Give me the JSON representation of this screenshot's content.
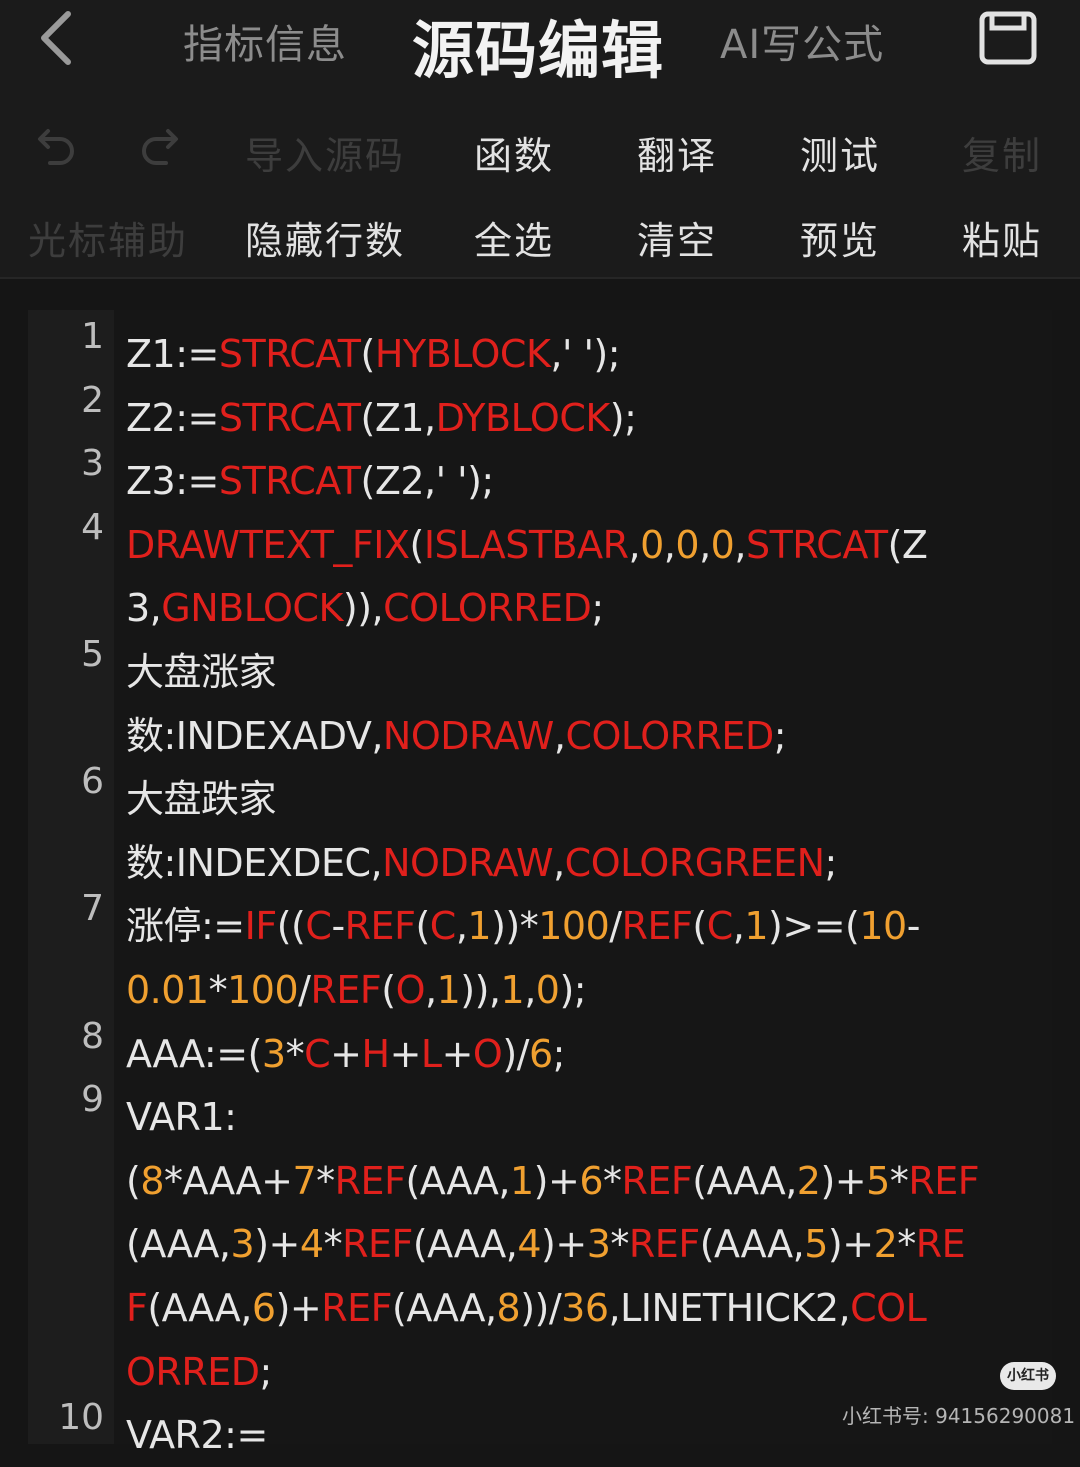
{
  "header": {
    "tabs": [
      {
        "label": "指标信息"
      },
      {
        "label": "源码编辑"
      },
      {
        "label": "AI写公式"
      }
    ]
  },
  "toolbar": {
    "row1": [
      "导入源码",
      "函数",
      "翻译",
      "测试",
      "复制"
    ],
    "row2": [
      "光标辅助",
      "隐藏行数",
      "全选",
      "清空",
      "预览",
      "粘贴"
    ]
  },
  "editor": {
    "line_numbers": [
      "1",
      "2",
      "3",
      "4",
      "5",
      "6",
      "7",
      "8",
      "9",
      "10"
    ],
    "lines": [
      {
        "ln": "1",
        "segs": [
          [
            "Z1:=",
            ""
          ],
          [
            "STRCAT",
            "r"
          ],
          [
            "(",
            ""
          ],
          [
            "HYBLOCK",
            "r"
          ],
          [
            ",' ');",
            ""
          ]
        ]
      },
      {
        "ln": "2",
        "segs": [
          [
            "Z2:=",
            ""
          ],
          [
            "STRCAT",
            "r"
          ],
          [
            "(Z1,",
            ""
          ],
          [
            "DYBLOCK",
            "r"
          ],
          [
            ");",
            ""
          ]
        ]
      },
      {
        "ln": "3",
        "segs": [
          [
            "Z3:=",
            ""
          ],
          [
            "STRCAT",
            "r"
          ],
          [
            "(Z2,' ');",
            ""
          ]
        ]
      },
      {
        "ln": "4",
        "segs": [
          [
            "DRAWTEXT_FIX",
            "r"
          ],
          [
            "(",
            ""
          ],
          [
            "ISLASTBAR",
            "r"
          ],
          [
            ",",
            ""
          ],
          [
            "0",
            "o"
          ],
          [
            ",",
            ""
          ],
          [
            "0",
            "o"
          ],
          [
            ",",
            ""
          ],
          [
            "0",
            "o"
          ],
          [
            ",",
            ""
          ],
          [
            "STRCAT",
            "r"
          ],
          [
            "(Z",
            ""
          ]
        ]
      },
      {
        "ln": "",
        "segs": [
          [
            "3,",
            ""
          ],
          [
            "GNBLOCK",
            "r"
          ],
          [
            ")),",
            ""
          ],
          [
            "COLORRED",
            "r"
          ],
          [
            ";",
            ""
          ]
        ]
      },
      {
        "ln": "5",
        "segs": [
          [
            "大盘涨家",
            ""
          ]
        ]
      },
      {
        "ln": "",
        "segs": [
          [
            "数:INDEXADV,",
            ""
          ],
          [
            "NODRAW",
            "r"
          ],
          [
            ",",
            ""
          ],
          [
            "COLORRED",
            "r"
          ],
          [
            ";",
            ""
          ]
        ]
      },
      {
        "ln": "6",
        "segs": [
          [
            "大盘跌家",
            ""
          ]
        ]
      },
      {
        "ln": "",
        "segs": [
          [
            "数:INDEXDEC,",
            ""
          ],
          [
            "NODRAW",
            "r"
          ],
          [
            ",",
            ""
          ],
          [
            "COLORGREEN",
            "r"
          ],
          [
            ";",
            ""
          ]
        ]
      },
      {
        "ln": "7",
        "segs": [
          [
            "涨停:=",
            ""
          ],
          [
            "IF",
            "r"
          ],
          [
            "((",
            ""
          ],
          [
            "C",
            "r"
          ],
          [
            "-",
            ""
          ],
          [
            "REF",
            "r"
          ],
          [
            "(",
            ""
          ],
          [
            "C",
            "r"
          ],
          [
            ",",
            ""
          ],
          [
            "1",
            "o"
          ],
          [
            "))*",
            ""
          ],
          [
            "100",
            "o"
          ],
          [
            "/",
            ""
          ],
          [
            "REF",
            "r"
          ],
          [
            "(",
            ""
          ],
          [
            "C",
            "r"
          ],
          [
            ",",
            ""
          ],
          [
            "1",
            "o"
          ],
          [
            ")>=(",
            ""
          ],
          [
            "10",
            "o"
          ],
          [
            "-",
            ""
          ]
        ]
      },
      {
        "ln": "",
        "segs": [
          [
            "0.01",
            "o"
          ],
          [
            "*",
            ""
          ],
          [
            "100",
            "o"
          ],
          [
            "/",
            ""
          ],
          [
            "REF",
            "r"
          ],
          [
            "(",
            ""
          ],
          [
            "O",
            "r"
          ],
          [
            ",",
            ""
          ],
          [
            "1",
            "o"
          ],
          [
            ")),",
            ""
          ],
          [
            "1",
            "o"
          ],
          [
            ",",
            ""
          ],
          [
            "0",
            "o"
          ],
          [
            ");",
            ""
          ]
        ]
      },
      {
        "ln": "8",
        "segs": [
          [
            "AAA:=(",
            ""
          ],
          [
            "3",
            "o"
          ],
          [
            "*",
            ""
          ],
          [
            "C",
            "r"
          ],
          [
            "+",
            ""
          ],
          [
            "H",
            "r"
          ],
          [
            "+",
            ""
          ],
          [
            "L",
            "r"
          ],
          [
            "+",
            ""
          ],
          [
            "O",
            "r"
          ],
          [
            ")/",
            ""
          ],
          [
            "6",
            "o"
          ],
          [
            ";",
            ""
          ]
        ]
      },
      {
        "ln": "9",
        "segs": [
          [
            "VAR1:",
            ""
          ]
        ]
      },
      {
        "ln": "",
        "segs": [
          [
            "(",
            ""
          ],
          [
            "8",
            "o"
          ],
          [
            "*AAA+",
            ""
          ],
          [
            "7",
            "o"
          ],
          [
            "*",
            ""
          ],
          [
            "REF",
            "r"
          ],
          [
            "(AAA,",
            ""
          ],
          [
            "1",
            "o"
          ],
          [
            ")+",
            ""
          ],
          [
            "6",
            "o"
          ],
          [
            "*",
            ""
          ],
          [
            "REF",
            "r"
          ],
          [
            "(AAA,",
            ""
          ],
          [
            "2",
            "o"
          ],
          [
            ")+",
            ""
          ],
          [
            "5",
            "o"
          ],
          [
            "*",
            ""
          ],
          [
            "REF",
            "r"
          ]
        ]
      },
      {
        "ln": "",
        "segs": [
          [
            "(AAA,",
            ""
          ],
          [
            "3",
            "o"
          ],
          [
            ")+",
            ""
          ],
          [
            "4",
            "o"
          ],
          [
            "*",
            ""
          ],
          [
            "REF",
            "r"
          ],
          [
            "(AAA,",
            ""
          ],
          [
            "4",
            "o"
          ],
          [
            ")+",
            ""
          ],
          [
            "3",
            "o"
          ],
          [
            "*",
            ""
          ],
          [
            "REF",
            "r"
          ],
          [
            "(AAA,",
            ""
          ],
          [
            "5",
            "o"
          ],
          [
            ")+",
            ""
          ],
          [
            "2",
            "o"
          ],
          [
            "*",
            ""
          ],
          [
            "RE",
            "r"
          ]
        ]
      },
      {
        "ln": "",
        "segs": [
          [
            "F",
            "r"
          ],
          [
            "(AAA,",
            ""
          ],
          [
            "6",
            "o"
          ],
          [
            ")+",
            ""
          ],
          [
            "REF",
            "r"
          ],
          [
            "(AAA,",
            ""
          ],
          [
            "8",
            "o"
          ],
          [
            "))/",
            ""
          ],
          [
            "36",
            "o"
          ],
          [
            ",LINETHICK2,",
            ""
          ],
          [
            "COL",
            "r"
          ]
        ]
      },
      {
        "ln": "",
        "segs": [
          [
            "ORRED",
            "r"
          ],
          [
            ";",
            ""
          ]
        ]
      },
      {
        "ln": "10",
        "segs": [
          [
            "VAR2:=",
            ""
          ]
        ]
      }
    ]
  },
  "watermark": {
    "badge": "小红书",
    "text": "小红书号: 94156290081"
  },
  "colors": {
    "keyword": "#e0201c",
    "number": "#f0a030",
    "text": "#e6e6e6",
    "background": "#151515"
  }
}
